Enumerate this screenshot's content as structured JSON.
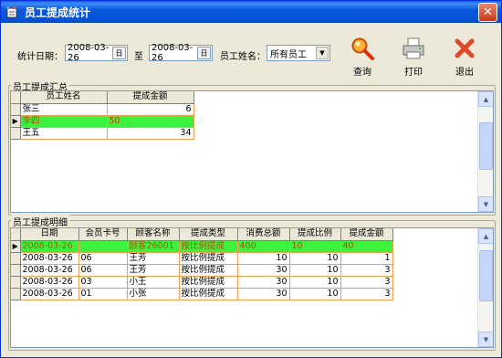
{
  "window": {
    "title": "员工提成统计"
  },
  "filters": {
    "date_label": "统计日期：",
    "start_date": "2008-03-26",
    "to_label": "至",
    "end_date": "2008-03-26",
    "calendar_label": "日",
    "employee_label": "员工姓名：",
    "employee_selected": "所有员工"
  },
  "toolbar": {
    "query_label": "查询",
    "print_label": "打印",
    "exit_label": "退出"
  },
  "summary": {
    "legend": "员工提成汇总",
    "columns": [
      "员工姓名",
      "提成金额"
    ],
    "rows": [
      [
        "张三",
        "6"
      ],
      [
        "李四",
        "50"
      ],
      [
        "王五",
        "34"
      ]
    ],
    "selected_row": 1
  },
  "detail": {
    "legend": "员工提成明细",
    "columns": [
      "日期",
      "会员卡号",
      "顾客名称",
      "提成类型",
      "消费总额",
      "提成比例",
      "提成金额"
    ],
    "rows": [
      [
        "2008-03-26",
        "",
        "顾客26001",
        "按比例提成",
        "400",
        "10",
        "40"
      ],
      [
        "2008-03-26",
        "06",
        "王芳",
        "按比例提成",
        "10",
        "10",
        "1"
      ],
      [
        "2008-03-26",
        "06",
        "王芳",
        "按比例提成",
        "30",
        "10",
        "3"
      ],
      [
        "2008-03-26",
        "03",
        "小王",
        "按比例提成",
        "30",
        "10",
        "3"
      ],
      [
        "2008-03-26",
        "01",
        "小张",
        "按比例提成",
        "30",
        "10",
        "3"
      ]
    ],
    "selected_row": 0
  },
  "icons": {
    "app": "app-icon",
    "query": "magnifier-icon",
    "print": "printer-icon",
    "exit": "red-x-icon",
    "calendar": "calendar-icon",
    "dropdown": "dropdown-arrow-icon",
    "row_indicator": "row-pointer-icon"
  }
}
